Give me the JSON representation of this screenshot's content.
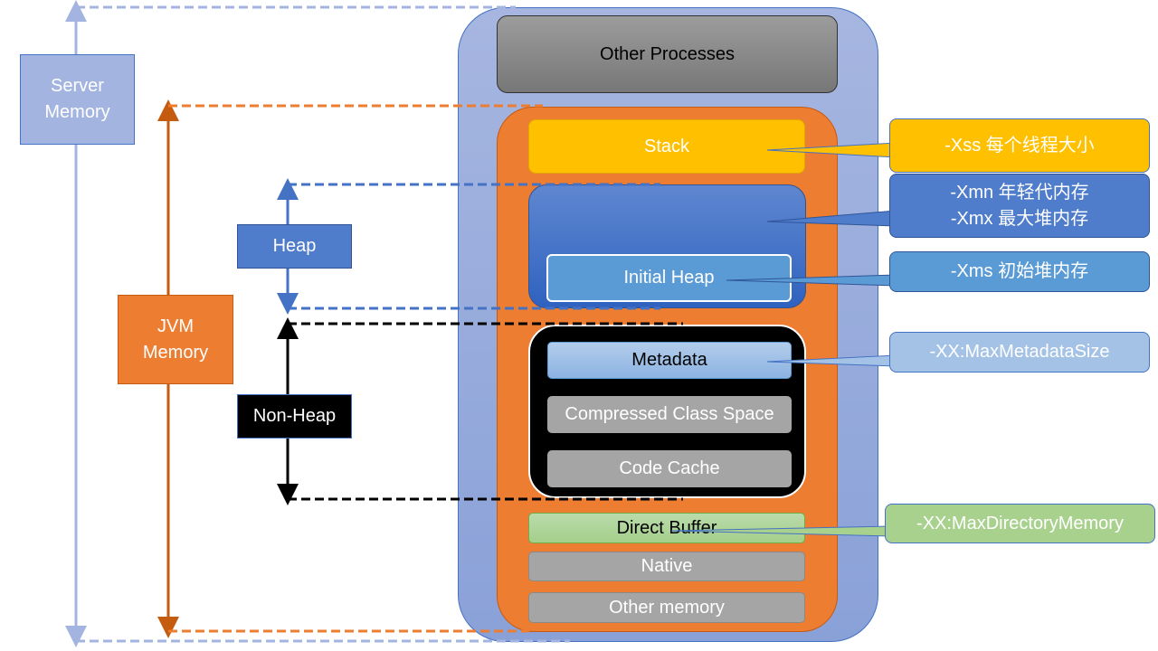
{
  "left_labels": {
    "server_memory": [
      "Server",
      "Memory"
    ],
    "jvm_memory": [
      "JVM",
      "Memory"
    ],
    "heap": "Heap",
    "non_heap": "Non-Heap"
  },
  "blocks": {
    "other_processes": "Other Processes",
    "stack": "Stack",
    "initial_heap": "Initial Heap",
    "metadata": "Metadata",
    "compressed_class_space": "Compressed Class Space",
    "code_cache": "Code Cache",
    "direct_buffer": "Direct Buffer",
    "native": "Native",
    "other_memory": "Other memory"
  },
  "callouts": {
    "xss": "-Xss 每个线程大小",
    "xmn": "-Xmn 年轻代内存",
    "xmx": "-Xmx 最大堆内存",
    "xms": "-Xms 初始堆内存",
    "max_metadata": "-XX:MaxMetadataSize",
    "max_direct": "-XX:MaxDirectoryMemory"
  },
  "colors": {
    "server": "#a4b4e0",
    "jvm": "#ed7d31",
    "heap": "#4472c4",
    "stack": "#ffc000",
    "non_heap": "#000000",
    "direct_buffer": "#a9d18e",
    "gray_block": "#a5a5a5"
  }
}
